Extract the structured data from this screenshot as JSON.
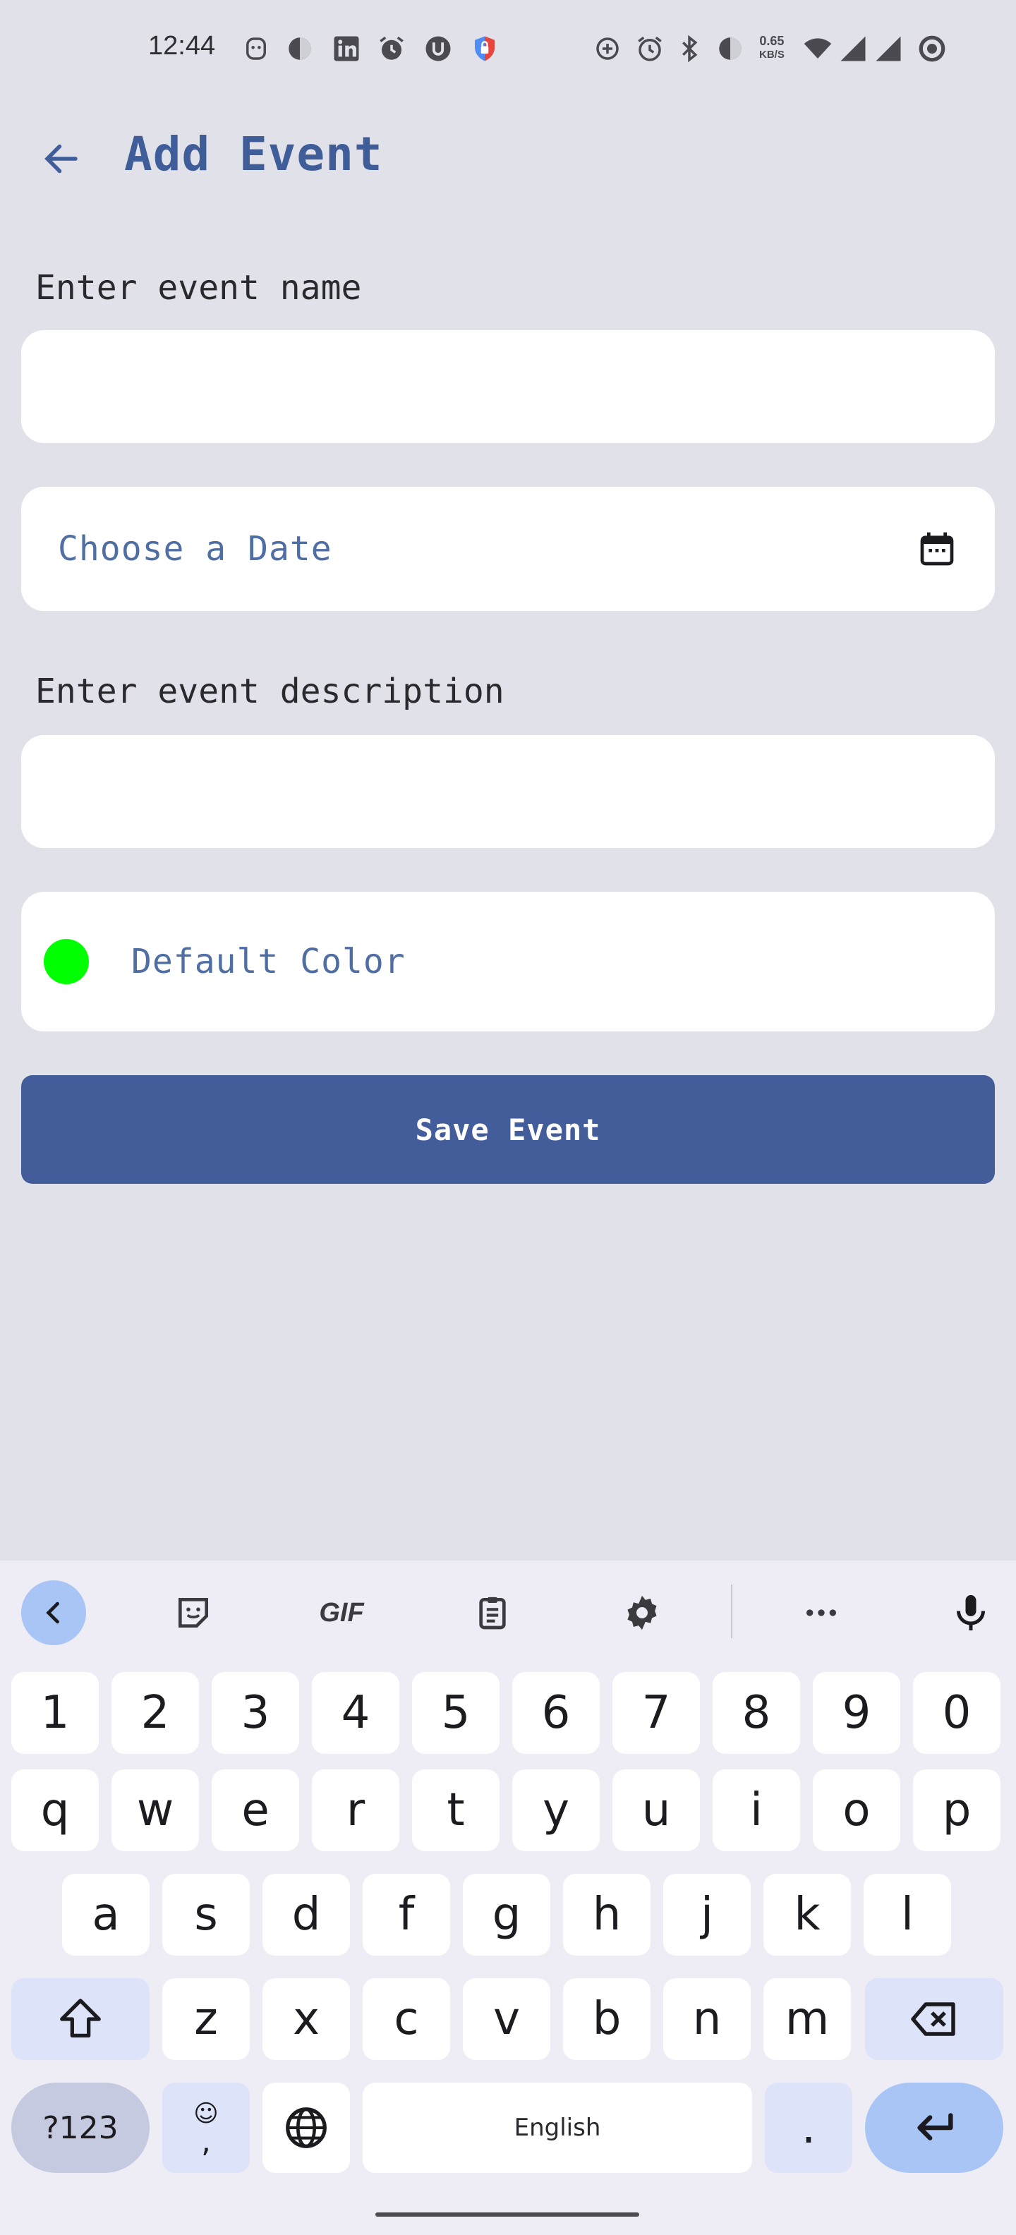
{
  "status_bar": {
    "time": "12:44",
    "net_speed_value": "0.65",
    "net_speed_unit": "KB/S",
    "left_icons": [
      "face-icon",
      "vpn-icon",
      "linkedin-icon",
      "alarm-icon",
      "u-app-icon",
      "shield-icon"
    ],
    "right_icons": [
      "data-saver-icon",
      "alarm-icon",
      "bluetooth-icon",
      "vpn-icon",
      "wifi-icon",
      "signal-icon",
      "signal-icon",
      "ring-icon"
    ]
  },
  "app_bar": {
    "title": "Add Event",
    "back_icon": "arrow-back-icon"
  },
  "form": {
    "name_label": "Enter event name",
    "name_value": "",
    "date_placeholder": "Choose a Date",
    "description_label": "Enter event description",
    "description_value": "",
    "color_label": "Default Color",
    "color_value": "#00ff00",
    "save_label": "Save Event"
  },
  "colors": {
    "accent": "#425d99",
    "background": "#e1e1ea"
  },
  "keyboard": {
    "toolbar": [
      "chevron-left-icon",
      "sticker-icon",
      "GIF",
      "clipboard-icon",
      "gear-icon",
      "more-icon",
      "mic-icon"
    ],
    "gif_label": "GIF",
    "row_numbers": [
      "1",
      "2",
      "3",
      "4",
      "5",
      "6",
      "7",
      "8",
      "9",
      "0"
    ],
    "row1": [
      "q",
      "w",
      "e",
      "r",
      "t",
      "y",
      "u",
      "i",
      "o",
      "p"
    ],
    "row2": [
      "a",
      "s",
      "d",
      "f",
      "g",
      "h",
      "j",
      "k",
      "l"
    ],
    "row3": [
      "z",
      "x",
      "c",
      "v",
      "b",
      "n",
      "m"
    ],
    "symbols_label": "?123",
    "comma_label": ",",
    "space_label": "English",
    "period_label": "."
  }
}
